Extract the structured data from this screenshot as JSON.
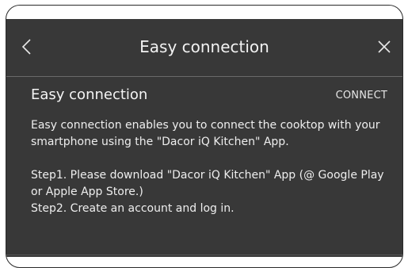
{
  "header": {
    "title": "Easy connection",
    "back_icon": "chevron-left-icon",
    "close_icon": "close-icon"
  },
  "section": {
    "title": "Easy connection",
    "connect_label": "CONNECT"
  },
  "content": {
    "paragraph1": "Easy connection enables you to connect the cooktop with your smartphone using the \"Dacor iQ Kitchen\" App.",
    "step1": "Step1. Please download \"Dacor iQ Kitchen\" App (@ Google Play or Apple App Store.)",
    "step2": "Step2. Create an account and log in."
  },
  "colors": {
    "screen_background": "#383838",
    "text": "#eeeeee",
    "divider": "#6a6a6a"
  }
}
